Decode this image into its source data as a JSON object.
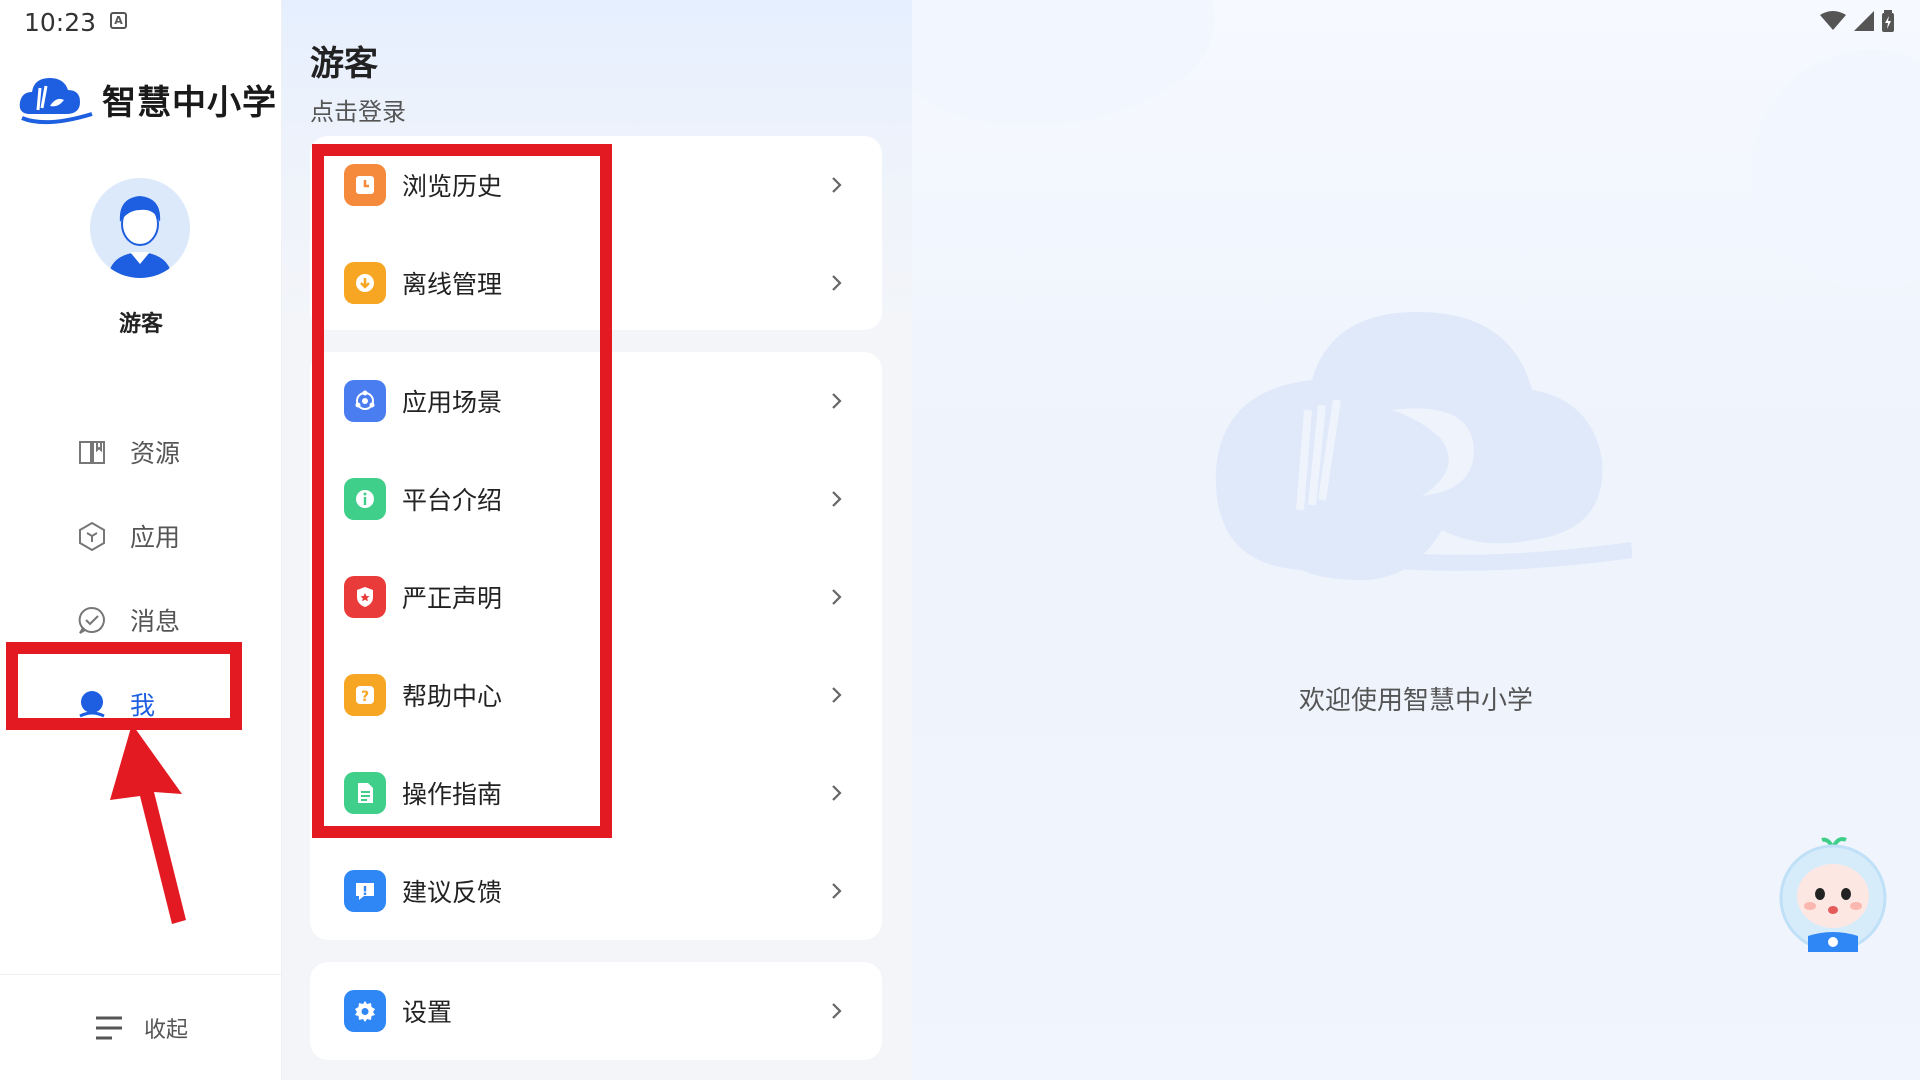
{
  "status": {
    "time": "10:23",
    "a_icon": "A"
  },
  "brand": {
    "name": "智慧中小学"
  },
  "user": {
    "name": "游客"
  },
  "nav": [
    {
      "label": "资源",
      "icon": "book-icon"
    },
    {
      "label": "应用",
      "icon": "cube-icon"
    },
    {
      "label": "消息",
      "icon": "message-icon"
    },
    {
      "label": "我",
      "icon": "person-icon",
      "active": true
    }
  ],
  "collapse_label": "收起",
  "profile": {
    "title": "游客",
    "login_link": "点击登录"
  },
  "groups": [
    [
      {
        "label": "浏览历史",
        "icon": "history-icon",
        "color": "#f58a3c"
      },
      {
        "label": "离线管理",
        "icon": "download-icon",
        "color": "#f6a623"
      }
    ],
    [
      {
        "label": "应用场景",
        "icon": "scene-icon",
        "color": "#4a7df0"
      },
      {
        "label": "平台介绍",
        "icon": "info-icon",
        "color": "#3fcf8a"
      },
      {
        "label": "严正声明",
        "icon": "shield-icon",
        "color": "#ea3b3b"
      },
      {
        "label": "帮助中心",
        "icon": "help-icon",
        "color": "#f6a623"
      },
      {
        "label": "操作指南",
        "icon": "guide-icon",
        "color": "#3fcf8a"
      },
      {
        "label": "建议反馈",
        "icon": "feedback-icon",
        "color": "#2f86f5"
      }
    ],
    [
      {
        "label": "设置",
        "icon": "settings-icon",
        "color": "#2f86f5"
      }
    ]
  ],
  "welcome": "欢迎使用智慧中小学",
  "colors": {
    "accent": "#1d5fe0",
    "annotation": "#e41a22"
  }
}
